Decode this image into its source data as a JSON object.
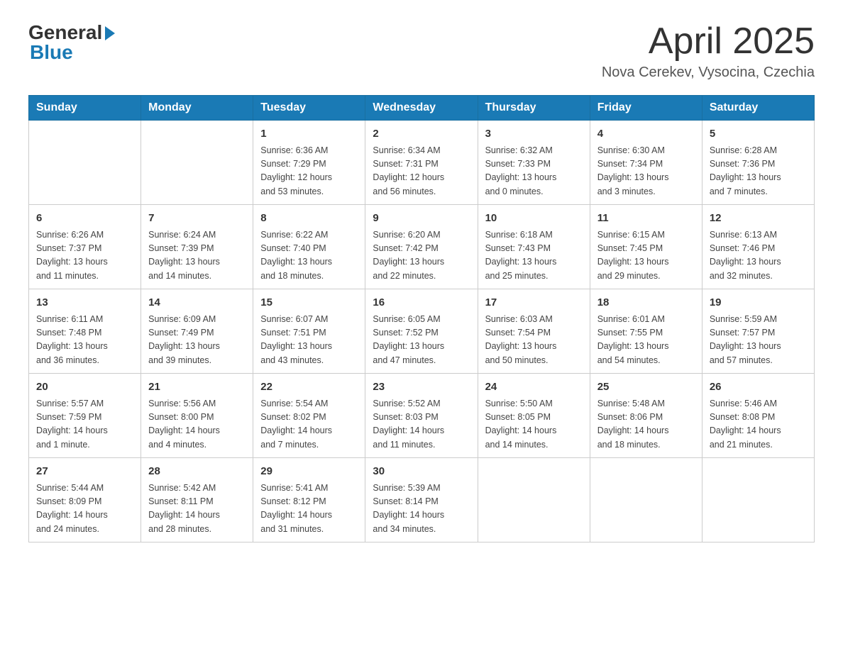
{
  "logo": {
    "general": "General",
    "blue": "Blue"
  },
  "header": {
    "month": "April 2025",
    "location": "Nova Cerekev, Vysocina, Czechia"
  },
  "days_of_week": [
    "Sunday",
    "Monday",
    "Tuesday",
    "Wednesday",
    "Thursday",
    "Friday",
    "Saturday"
  ],
  "weeks": [
    [
      {
        "day": "",
        "info": ""
      },
      {
        "day": "",
        "info": ""
      },
      {
        "day": "1",
        "info": "Sunrise: 6:36 AM\nSunset: 7:29 PM\nDaylight: 12 hours\nand 53 minutes."
      },
      {
        "day": "2",
        "info": "Sunrise: 6:34 AM\nSunset: 7:31 PM\nDaylight: 12 hours\nand 56 minutes."
      },
      {
        "day": "3",
        "info": "Sunrise: 6:32 AM\nSunset: 7:33 PM\nDaylight: 13 hours\nand 0 minutes."
      },
      {
        "day": "4",
        "info": "Sunrise: 6:30 AM\nSunset: 7:34 PM\nDaylight: 13 hours\nand 3 minutes."
      },
      {
        "day": "5",
        "info": "Sunrise: 6:28 AM\nSunset: 7:36 PM\nDaylight: 13 hours\nand 7 minutes."
      }
    ],
    [
      {
        "day": "6",
        "info": "Sunrise: 6:26 AM\nSunset: 7:37 PM\nDaylight: 13 hours\nand 11 minutes."
      },
      {
        "day": "7",
        "info": "Sunrise: 6:24 AM\nSunset: 7:39 PM\nDaylight: 13 hours\nand 14 minutes."
      },
      {
        "day": "8",
        "info": "Sunrise: 6:22 AM\nSunset: 7:40 PM\nDaylight: 13 hours\nand 18 minutes."
      },
      {
        "day": "9",
        "info": "Sunrise: 6:20 AM\nSunset: 7:42 PM\nDaylight: 13 hours\nand 22 minutes."
      },
      {
        "day": "10",
        "info": "Sunrise: 6:18 AM\nSunset: 7:43 PM\nDaylight: 13 hours\nand 25 minutes."
      },
      {
        "day": "11",
        "info": "Sunrise: 6:15 AM\nSunset: 7:45 PM\nDaylight: 13 hours\nand 29 minutes."
      },
      {
        "day": "12",
        "info": "Sunrise: 6:13 AM\nSunset: 7:46 PM\nDaylight: 13 hours\nand 32 minutes."
      }
    ],
    [
      {
        "day": "13",
        "info": "Sunrise: 6:11 AM\nSunset: 7:48 PM\nDaylight: 13 hours\nand 36 minutes."
      },
      {
        "day": "14",
        "info": "Sunrise: 6:09 AM\nSunset: 7:49 PM\nDaylight: 13 hours\nand 39 minutes."
      },
      {
        "day": "15",
        "info": "Sunrise: 6:07 AM\nSunset: 7:51 PM\nDaylight: 13 hours\nand 43 minutes."
      },
      {
        "day": "16",
        "info": "Sunrise: 6:05 AM\nSunset: 7:52 PM\nDaylight: 13 hours\nand 47 minutes."
      },
      {
        "day": "17",
        "info": "Sunrise: 6:03 AM\nSunset: 7:54 PM\nDaylight: 13 hours\nand 50 minutes."
      },
      {
        "day": "18",
        "info": "Sunrise: 6:01 AM\nSunset: 7:55 PM\nDaylight: 13 hours\nand 54 minutes."
      },
      {
        "day": "19",
        "info": "Sunrise: 5:59 AM\nSunset: 7:57 PM\nDaylight: 13 hours\nand 57 minutes."
      }
    ],
    [
      {
        "day": "20",
        "info": "Sunrise: 5:57 AM\nSunset: 7:59 PM\nDaylight: 14 hours\nand 1 minute."
      },
      {
        "day": "21",
        "info": "Sunrise: 5:56 AM\nSunset: 8:00 PM\nDaylight: 14 hours\nand 4 minutes."
      },
      {
        "day": "22",
        "info": "Sunrise: 5:54 AM\nSunset: 8:02 PM\nDaylight: 14 hours\nand 7 minutes."
      },
      {
        "day": "23",
        "info": "Sunrise: 5:52 AM\nSunset: 8:03 PM\nDaylight: 14 hours\nand 11 minutes."
      },
      {
        "day": "24",
        "info": "Sunrise: 5:50 AM\nSunset: 8:05 PM\nDaylight: 14 hours\nand 14 minutes."
      },
      {
        "day": "25",
        "info": "Sunrise: 5:48 AM\nSunset: 8:06 PM\nDaylight: 14 hours\nand 18 minutes."
      },
      {
        "day": "26",
        "info": "Sunrise: 5:46 AM\nSunset: 8:08 PM\nDaylight: 14 hours\nand 21 minutes."
      }
    ],
    [
      {
        "day": "27",
        "info": "Sunrise: 5:44 AM\nSunset: 8:09 PM\nDaylight: 14 hours\nand 24 minutes."
      },
      {
        "day": "28",
        "info": "Sunrise: 5:42 AM\nSunset: 8:11 PM\nDaylight: 14 hours\nand 28 minutes."
      },
      {
        "day": "29",
        "info": "Sunrise: 5:41 AM\nSunset: 8:12 PM\nDaylight: 14 hours\nand 31 minutes."
      },
      {
        "day": "30",
        "info": "Sunrise: 5:39 AM\nSunset: 8:14 PM\nDaylight: 14 hours\nand 34 minutes."
      },
      {
        "day": "",
        "info": ""
      },
      {
        "day": "",
        "info": ""
      },
      {
        "day": "",
        "info": ""
      }
    ]
  ]
}
